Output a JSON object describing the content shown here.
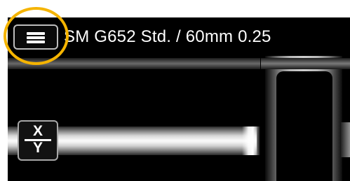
{
  "header": {
    "title": "SM G652 Std. / 60mm 0.25",
    "menu_icon": "hamburger-menu-icon"
  },
  "view_controls": {
    "xy_top": "X",
    "xy_bottom": "Y"
  },
  "colors": {
    "highlight": "#f5b400",
    "background": "#000000",
    "text": "#ffffff"
  }
}
